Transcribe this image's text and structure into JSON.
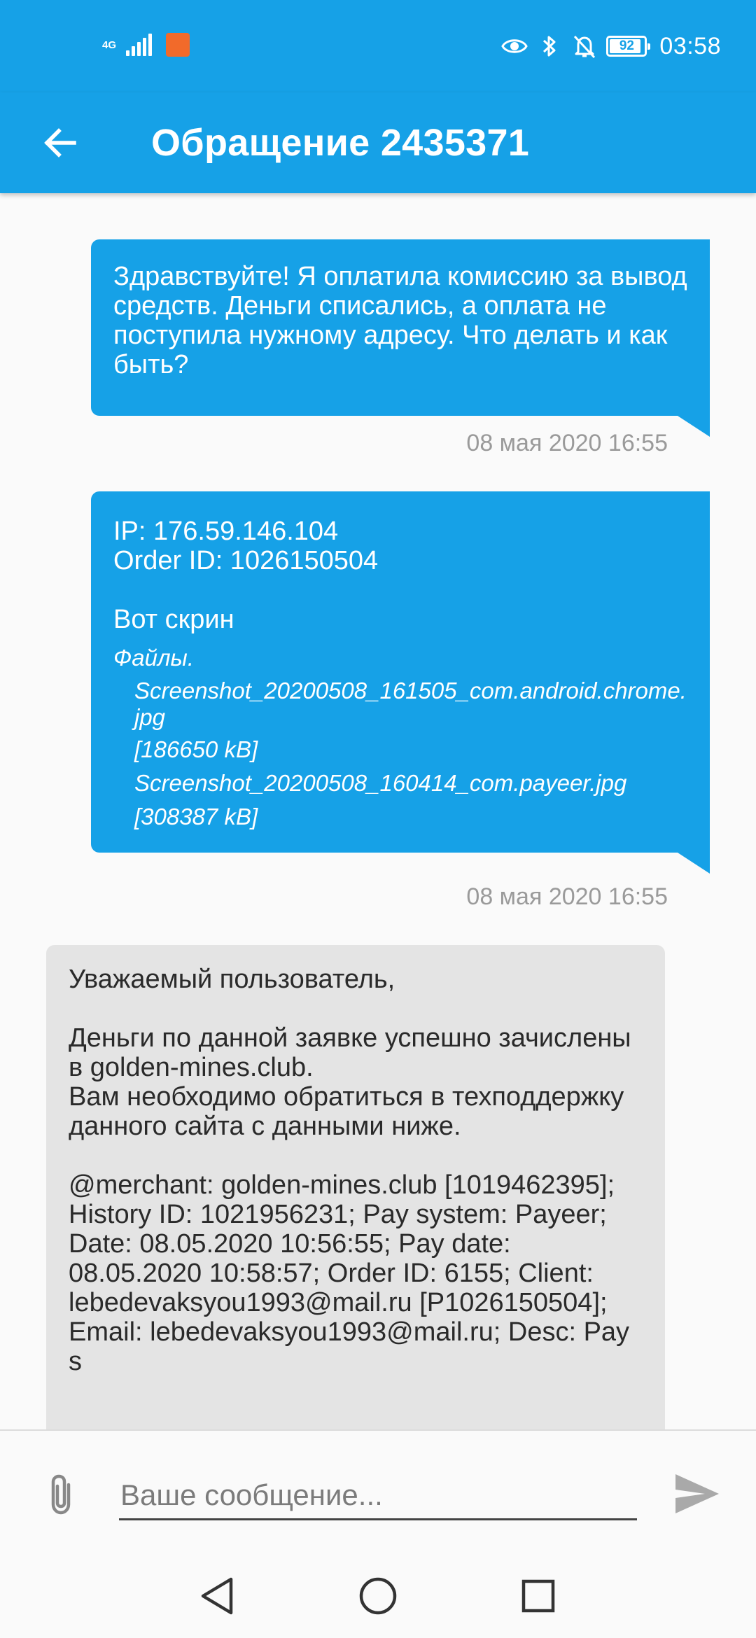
{
  "status_bar": {
    "network": "4G",
    "battery": "92",
    "time": "03:58"
  },
  "header": {
    "title": "Обращение 2435371"
  },
  "messages": [
    {
      "direction": "out",
      "text": "Здравствуйте! Я оплатила комиссию за вывод средств. Деньги списались, а оплата не поступила нужному адресу. Что делать и как быть?",
      "time": "08 мая 2020 16:55"
    },
    {
      "direction": "out",
      "ip_line": "IP: 176.59.146.104",
      "order_line": "Order ID: 1026150504",
      "text": "Вот скрин",
      "files_label": "Файлы.",
      "files": [
        {
          "name": "Screenshot_20200508_161505_com.android.chrome.jpg",
          "size": "[186650 kB]"
        },
        {
          "name": "Screenshot_20200508_160414_com.payeer.jpg",
          "size": "[308387 kB]"
        }
      ],
      "time": "08 мая 2020 16:55"
    },
    {
      "direction": "in",
      "greeting": "Уважаемый пользователь,",
      "body": "Деньги по данной заявке успешно зачислены в golden-mines.club.\nВам необходимо обратиться в техподдержку данного сайта с данными ниже.",
      "details": "@merchant: golden-mines.club [1019462395]; History ID: 1021956231; Pay system: Payeer; Date: 08.05.2020 10:56:55; Pay date: 08.05.2020 10:58:57; Order ID: 6155; Client: lebedevaksyou1993@mail.ru [P1026150504]; Email: lebedevaksyou1993@mail.ru; Desc: Pay s"
    }
  ],
  "composer": {
    "placeholder": "Ваше сообщение..."
  },
  "colors": {
    "primary": "#16a1e7",
    "incoming_bubble": "#e4e4e4",
    "timestamp": "#9a9a9a"
  },
  "icons": {
    "back": "arrow-left-icon",
    "attach": "paperclip-icon",
    "send": "send-icon",
    "nav_back": "triangle-back-icon",
    "nav_home": "circle-home-icon",
    "nav_recents": "square-recents-icon"
  }
}
